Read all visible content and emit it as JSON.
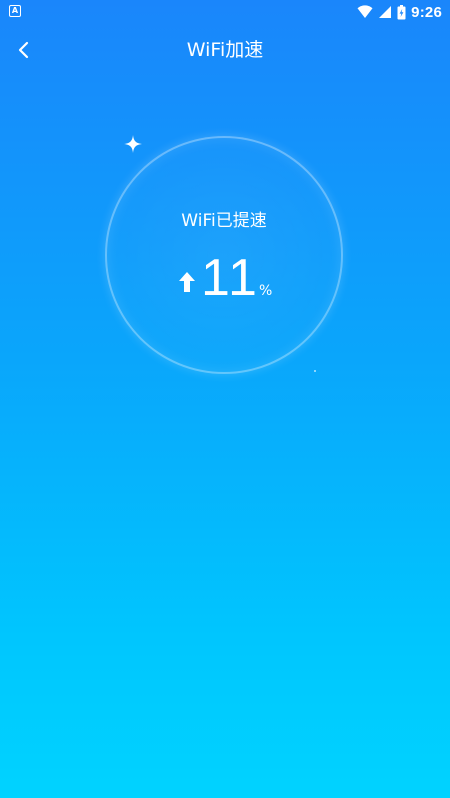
{
  "status_bar": {
    "notification_icon": "a-notification-icon",
    "time": "9:26",
    "icons": [
      "wifi-icon",
      "cell-signal-icon",
      "battery-icon"
    ]
  },
  "header": {
    "back_icon": "chevron-left-icon",
    "title": "WiFi加速"
  },
  "boost": {
    "label": "WiFi已提速",
    "direction_icon": "arrow-up-icon",
    "value": "11",
    "unit": "%",
    "percent": 11
  },
  "colors": {
    "gradient_top": "#1a86fb",
    "gradient_bottom": "#00d3ff",
    "text": "#ffffff"
  }
}
